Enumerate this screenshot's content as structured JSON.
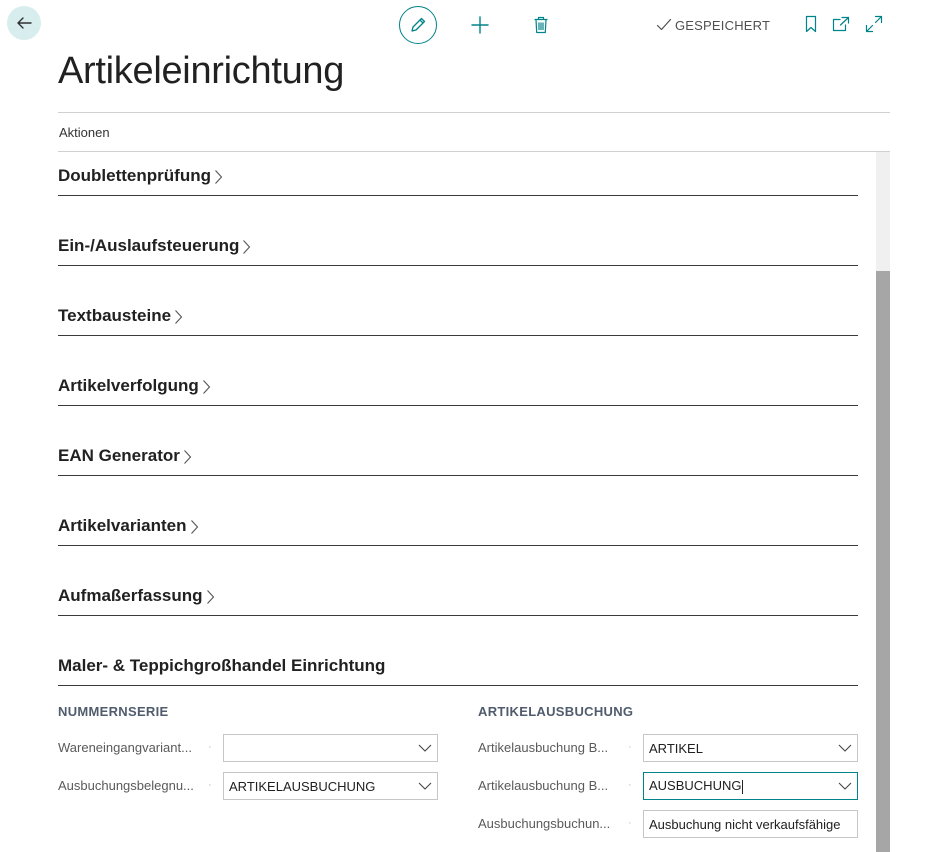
{
  "toolbar": {
    "back_icon": "arrow-left-icon",
    "edit_icon": "pencil-icon",
    "add_icon": "plus-icon",
    "delete_icon": "trash-icon",
    "saved_status": "GESPEICHERT",
    "bookmark_icon": "bookmark-icon",
    "share_icon": "open-in-new-icon",
    "expand_icon": "expand-icon"
  },
  "page": {
    "title": "Artikeleinrichtung",
    "actions_label": "Aktionen"
  },
  "fasttabs": [
    {
      "label": "Doublettenprüfung"
    },
    {
      "label": "Ein-/Auslaufsteuerung"
    },
    {
      "label": "Textbausteine"
    },
    {
      "label": "Artikelverfolgung"
    },
    {
      "label": "EAN Generator"
    },
    {
      "label": "Artikelvarianten"
    },
    {
      "label": "Aufmaßerfassung"
    },
    {
      "label": "Maler- & Teppichgroßhandel Einrichtung"
    }
  ],
  "expanded": {
    "left_group": {
      "heading": "NUMMERNSERIE",
      "fields": [
        {
          "label": "Wareneingangvariant...",
          "value": ""
        },
        {
          "label": "Ausbuchungsbelegnu...",
          "value": "ARTIKELAUSBUCHUNG"
        }
      ]
    },
    "right_group": {
      "heading": "ARTIKELAUSBUCHUNG",
      "fields": [
        {
          "label": "Artikelausbuchung B...",
          "value": "ARTIKEL"
        },
        {
          "label": "Artikelausbuchung B...",
          "value": "AUSBUCHUNG"
        },
        {
          "label": "Ausbuchungsbuchun...",
          "value": "Ausbuchung nicht verkaufsfähige"
        }
      ]
    }
  },
  "colors": {
    "accent": "#00838a",
    "back_button_bg": "#d8eeee",
    "scrollbar_thumb": "#a6a6a6"
  }
}
